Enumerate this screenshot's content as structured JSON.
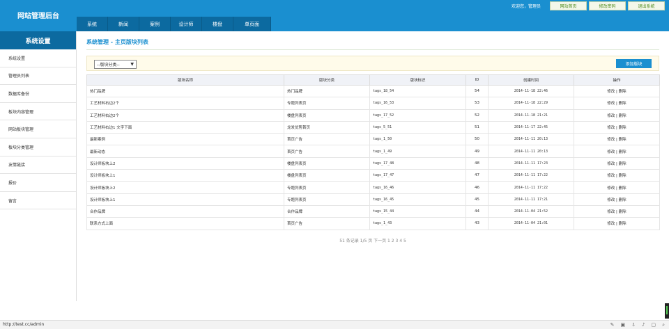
{
  "header": {
    "logo": "网站管理后台",
    "nav": [
      "系统",
      "新闻",
      "案例",
      "设计师",
      "楼盘",
      "单页面"
    ],
    "welcome": "欢迎您，管理员",
    "buttons": [
      "网站首页",
      "修改密码",
      "退出系统"
    ]
  },
  "sidebar": {
    "title": "系统设置",
    "items": [
      "系统设置",
      "管理员列表",
      "数据库备份",
      "板块内容管理",
      "网站板块管理",
      "板块分类管理",
      "友情链接",
      "报价",
      "留言"
    ]
  },
  "main": {
    "title": "系统管理 - 主页版块列表",
    "select_value": "--版块分类--",
    "add_button": "添加版块",
    "columns": [
      "版块名称",
      "版块分类",
      "版块标识",
      "ID",
      "创建时间",
      "操作"
    ],
    "rows": [
      {
        "name": "热门品牌",
        "cat": "热门品牌",
        "tag": "tags_18_54",
        "id": "54",
        "time": "2014-11-18 22:46"
      },
      {
        "name": "工艺材料右边2个",
        "cat": "专题列表页",
        "tag": "tags_16_53",
        "id": "53",
        "time": "2014-11-18 22:29"
      },
      {
        "name": "工艺材料右边2个",
        "cat": "楼盘列表页",
        "tag": "tags_17_52",
        "id": "52",
        "time": "2014-11-18 21:21"
      },
      {
        "name": "工艺材料右边1 文字下面",
        "cat": "龙发优势首页",
        "tag": "tags_5_51",
        "id": "51",
        "time": "2014-11-17 22:45"
      },
      {
        "name": "最新案例",
        "cat": "首页广告",
        "tag": "tags_1_50",
        "id": "50",
        "time": "2014-11-11 20:13"
      },
      {
        "name": "最新动态",
        "cat": "首页广告",
        "tag": "tags_1_49",
        "id": "49",
        "time": "2014-11-11 20:13"
      },
      {
        "name": "设计师板块上2",
        "cat": "楼盘列表页",
        "tag": "tags_17_48",
        "id": "48",
        "time": "2014-11-11 17:23"
      },
      {
        "name": "设计师板块上1",
        "cat": "楼盘列表页",
        "tag": "tags_17_47",
        "id": "47",
        "time": "2014-11-11 17:22"
      },
      {
        "name": "设计师板块上2",
        "cat": "专题列表页",
        "tag": "tags_16_46",
        "id": "46",
        "time": "2014-11-11 17:22"
      },
      {
        "name": "设计师板块上1",
        "cat": "专题列表页",
        "tag": "tags_16_45",
        "id": "45",
        "time": "2014-11-11 17:21"
      },
      {
        "name": "合作品牌",
        "cat": "合作品牌",
        "tag": "tags_15_44",
        "id": "44",
        "time": "2014-11-04 21:52"
      },
      {
        "name": "联系方式上面",
        "cat": "首页广告",
        "tag": "tags_1_43",
        "id": "43",
        "time": "2014-11-04 21:01"
      }
    ],
    "edit_label": "修改",
    "delete_label": "删除",
    "pager": "51 条记录 1/5 页  下一页  1 2 3 4 5"
  },
  "statusbar": {
    "url": "http://test.cc/admin",
    "icons": [
      "pin-icon",
      "screenshot-icon",
      "download-icon",
      "volume-icon",
      "window-icon",
      "zoom-icon"
    ]
  }
}
